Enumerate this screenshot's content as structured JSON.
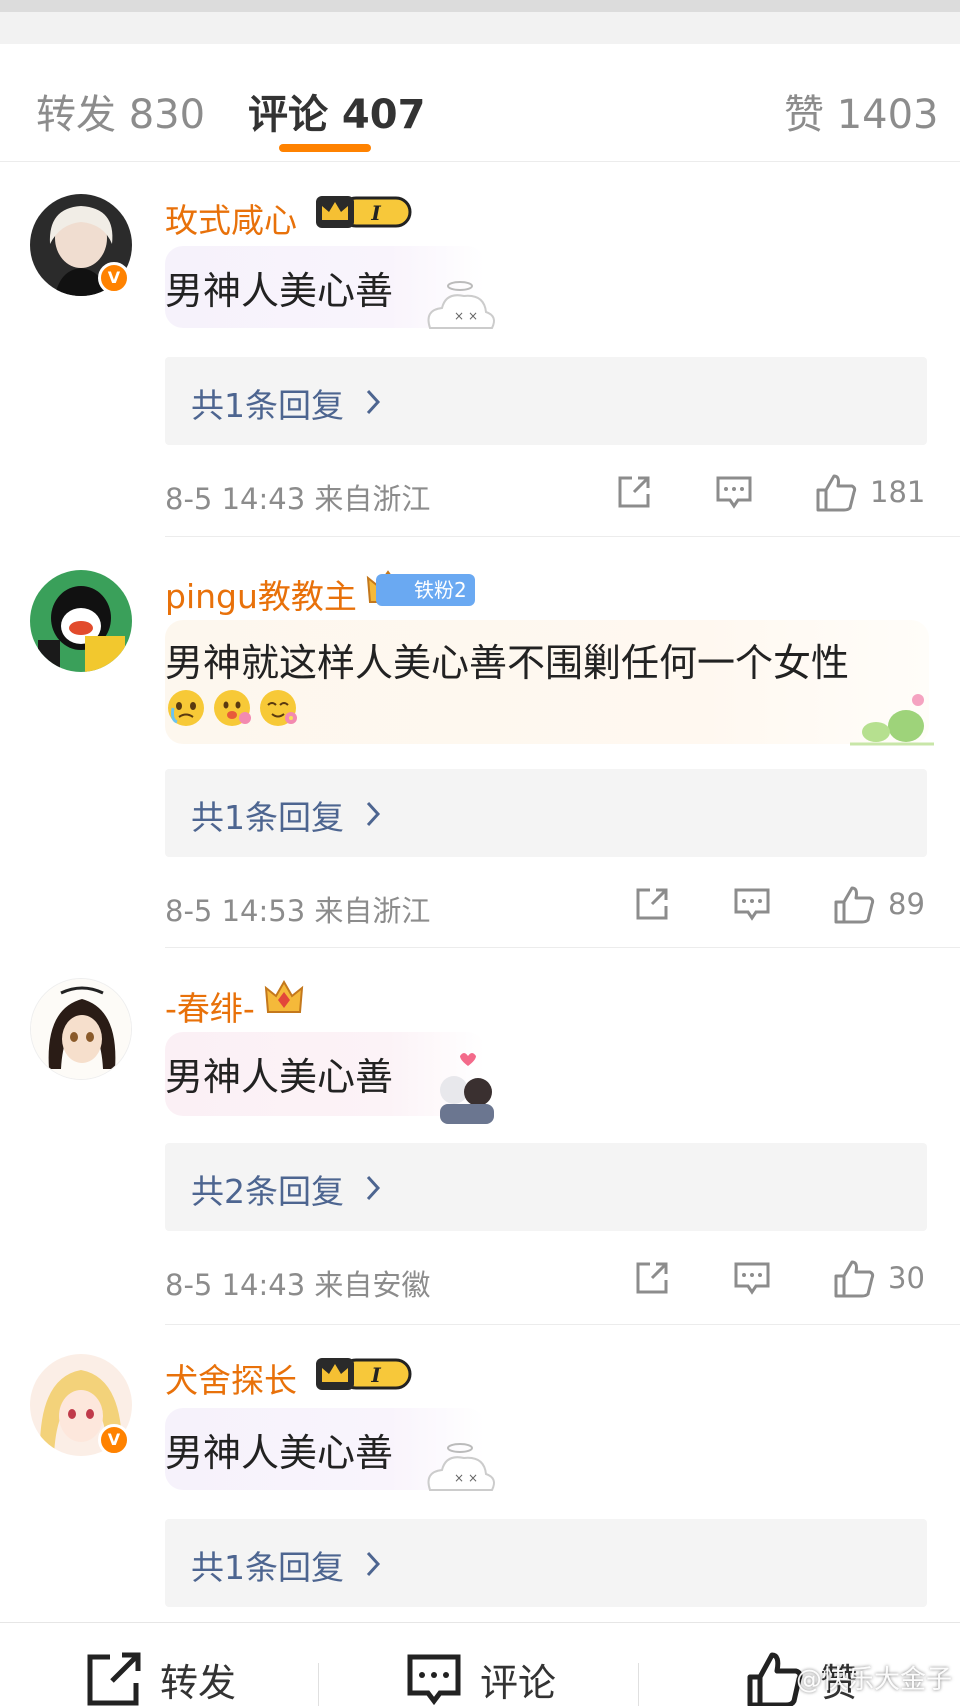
{
  "tabs": [
    {
      "label": "转发 830"
    },
    {
      "label": "评论 407"
    },
    {
      "label": "赞 1403"
    }
  ],
  "comments": [
    {
      "username": "玫式咸心",
      "vip_badge": "I",
      "text": "男神人美心善",
      "replies": "共1条回复",
      "time_location": "8-5 14:43  来自浙江",
      "likes": "181"
    },
    {
      "username": "pingu教教主",
      "fan_badge": "铁粉2",
      "text": "男神就这样人美心善不围剿任何一个女性",
      "replies": "共1条回复",
      "time_location": "8-5 14:53  来自浙江",
      "likes": "89"
    },
    {
      "username": "-春绯-",
      "text": "男神人美心善",
      "replies": "共2条回复",
      "time_location": "8-5 14:43  来自安徽",
      "likes": "30"
    },
    {
      "username": "犬舍探长",
      "vip_badge": "I",
      "text": "男神人美心善",
      "replies": "共1条回复"
    }
  ],
  "bottom_bar": {
    "repost": "转发",
    "comment": "评论",
    "like": "赞"
  },
  "watermark": "@快乐大金子",
  "colors": {
    "accent": "#ff8200",
    "username": "#e8710a",
    "reply_link": "#4d6590",
    "meta": "#8c8c8c"
  }
}
